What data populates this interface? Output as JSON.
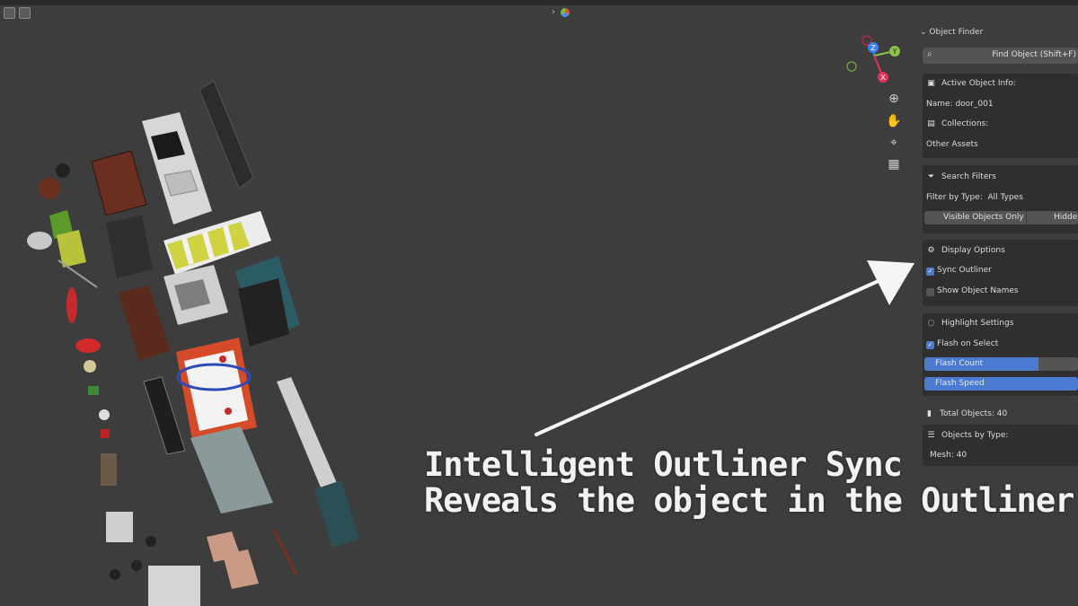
{
  "colors": {
    "viewport_bg": "#3d3d3d",
    "accent_blue": "#4a7bd0",
    "axis_x": "#e0325a",
    "axis_y": "#8bc34a",
    "axis_z": "#3b82f6"
  },
  "gizmo": {
    "x": "X",
    "y": "Y",
    "z": "Z"
  },
  "panel": {
    "title": "Object Finder",
    "search_placeholder": "Find Object (Shift+F)",
    "active_info": {
      "heading": "Active Object Info:",
      "name_line": "Name: door_001",
      "collections_heading": "Collections:",
      "collection_value": "Other Assets"
    },
    "filters": {
      "heading": "Search Filters",
      "filter_by_type_label": "Filter by Type:",
      "filter_by_type_value": "All Types",
      "visible_only": "Visible Objects Only",
      "hidden_label": "Hidden"
    },
    "display": {
      "heading": "Display Options",
      "sync_outliner": "Sync Outliner",
      "sync_outliner_checked": true,
      "show_names": "Show Object Names",
      "show_names_checked": false
    },
    "highlight": {
      "heading": "Highlight Settings",
      "flash_on_select": "Flash on Select",
      "flash_on_select_checked": true,
      "flash_count": "Flash Count",
      "flash_count_fill": 0.74,
      "flash_speed": "Flash Speed",
      "flash_speed_fill": 1.0
    },
    "stats": {
      "total": "Total Objects: 40",
      "by_type_heading": "Objects by Type:",
      "mesh": "Mesh: 40"
    }
  },
  "caption": {
    "line1": "Intelligent Outliner Sync",
    "line2": "Reveals the object in the Outliner"
  }
}
